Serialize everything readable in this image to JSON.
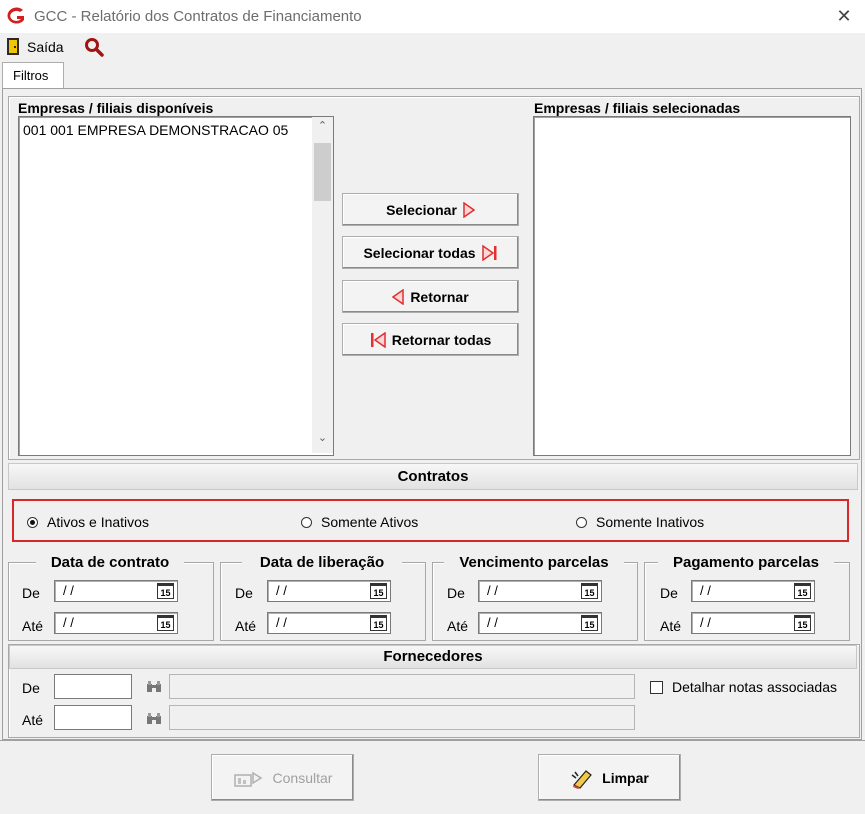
{
  "window": {
    "title": "GCC - Relatório dos Contratos de Financiamento",
    "close": "✕"
  },
  "toolbar": {
    "exit_label": "Saída"
  },
  "tabs": [
    {
      "label": "Filtros",
      "active": true
    }
  ],
  "companies": {
    "available_label": "Empresas / filiais disponíveis",
    "available_items": [
      "001 001 EMPRESA DEMONSTRACAO 05"
    ],
    "selected_label": "Empresas / filiais selecionadas",
    "selected_items": []
  },
  "transfer_buttons": {
    "select": "Selecionar",
    "select_all": "Selecionar todas",
    "return": "Retornar",
    "return_all": "Retornar todas"
  },
  "contracts": {
    "header": "Contratos",
    "options": [
      {
        "label": "Ativos e Inativos",
        "checked": true
      },
      {
        "label": "Somente Ativos",
        "checked": false
      },
      {
        "label": "Somente Inativos",
        "checked": false
      }
    ]
  },
  "date_groups": [
    {
      "title": "Data de contrato",
      "from_label": "De",
      "to_label": "Até",
      "from_value": " / /",
      "to_value": " / /"
    },
    {
      "title": "Data de liberação",
      "from_label": "De",
      "to_label": "Até",
      "from_value": " / /",
      "to_value": " / /"
    },
    {
      "title": "Vencimento parcelas",
      "from_label": "De",
      "to_label": "Até",
      "from_value": " / /",
      "to_value": " / /"
    },
    {
      "title": "Pagamento parcelas",
      "from_label": "De",
      "to_label": "Até",
      "from_value": " / /",
      "to_value": " / /"
    }
  ],
  "calendar_icon_text": "15",
  "suppliers": {
    "header": "Fornecedores",
    "from_label": "De",
    "to_label": "Até",
    "from_value": "",
    "to_value": "",
    "detail_checkbox_label": "Detalhar notas associadas",
    "detail_checked": false
  },
  "footer": {
    "consult_label": "Consultar",
    "clear_label": "Limpar",
    "consult_enabled": false
  },
  "colors": {
    "brand_red": "#d21f1f",
    "highlight_border": "#d9262b",
    "arrow_red": "#e03030"
  }
}
